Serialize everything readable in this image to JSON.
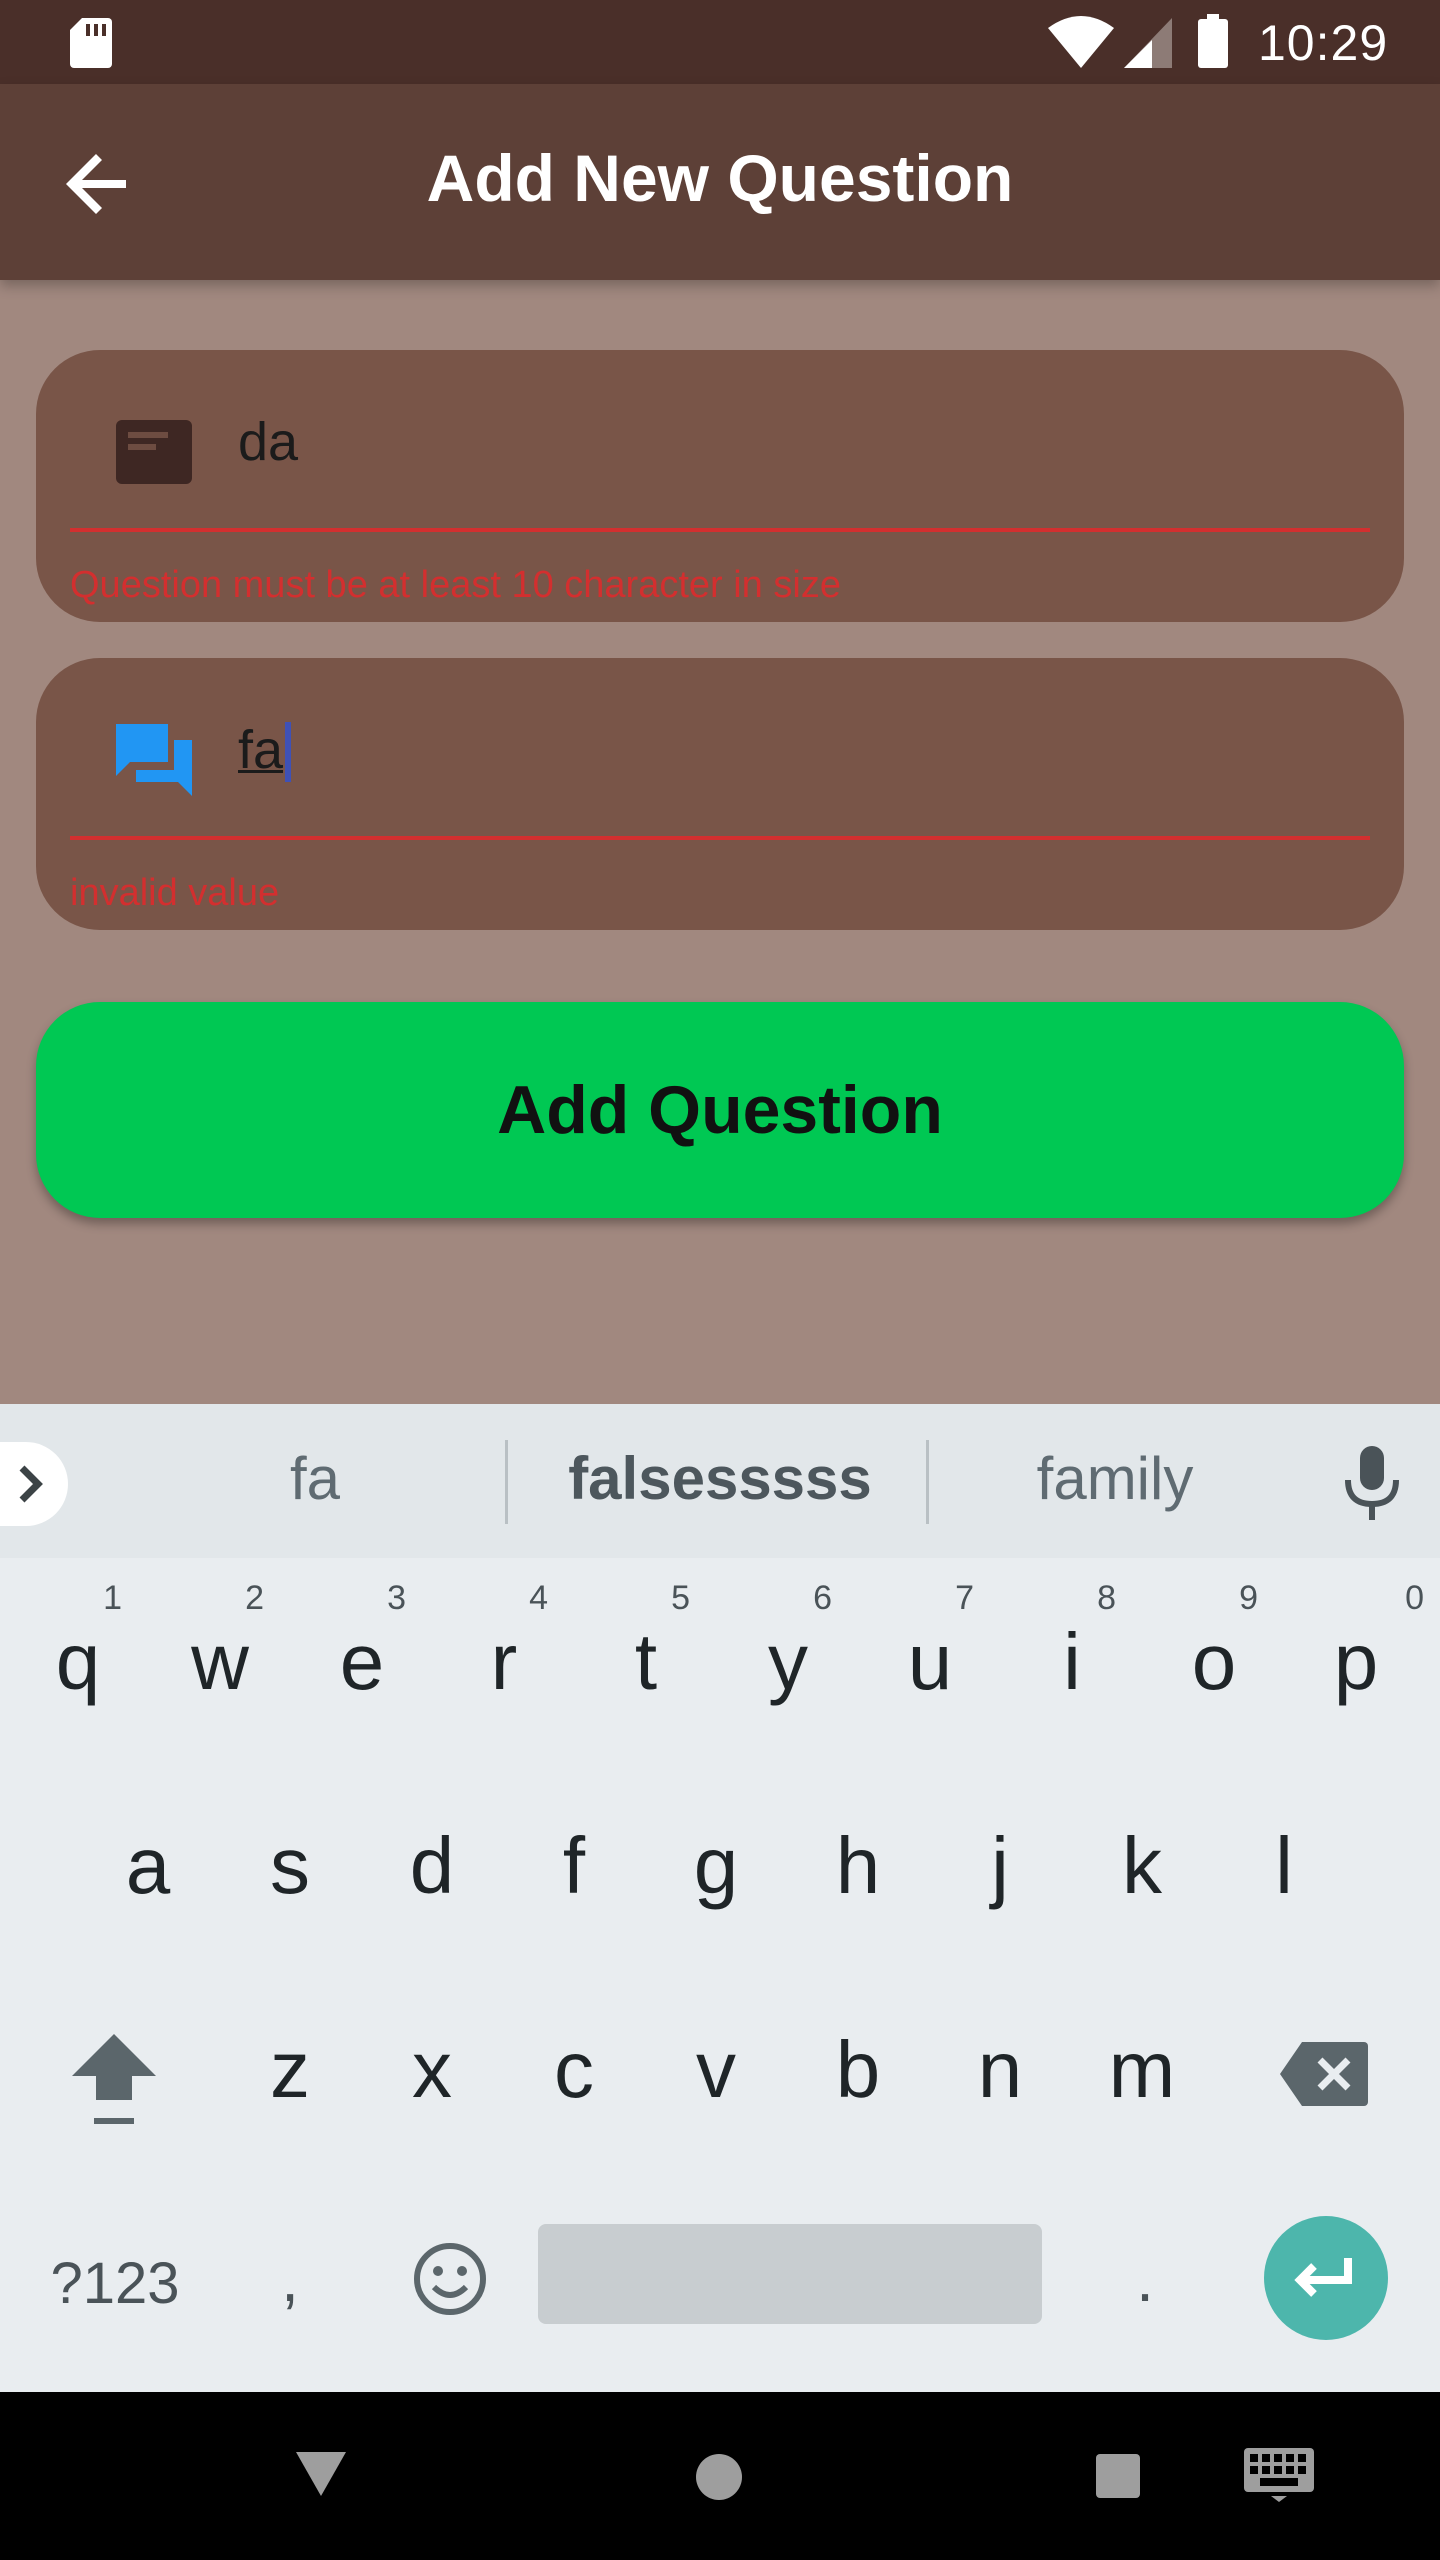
{
  "status_bar": {
    "time": "10:29"
  },
  "app_bar": {
    "title": "Add New Question",
    "back_icon": "arrow-back-icon"
  },
  "form": {
    "question_field": {
      "icon": "card-icon",
      "value": "da",
      "error": "Question must be at least 10 character in size"
    },
    "answer_field": {
      "icon": "forum-icon",
      "value": "fa",
      "error": "invalid value"
    },
    "submit_label": "Add Question"
  },
  "colors": {
    "status_bar": "#4a2f29",
    "app_bar": "#5d4037",
    "background": "#a1887f",
    "field": "#795548",
    "error": "#d32f2f",
    "button": "#00c853",
    "keyboard": "#e9edf0",
    "enter_key": "#4db6ac"
  },
  "keyboard": {
    "suggestions": [
      "fa",
      "falsesssss",
      "family"
    ],
    "row1": [
      {
        "key": "q",
        "hint": "1"
      },
      {
        "key": "w",
        "hint": "2"
      },
      {
        "key": "e",
        "hint": "3"
      },
      {
        "key": "r",
        "hint": "4"
      },
      {
        "key": "t",
        "hint": "5"
      },
      {
        "key": "y",
        "hint": "6"
      },
      {
        "key": "u",
        "hint": "7"
      },
      {
        "key": "i",
        "hint": "8"
      },
      {
        "key": "o",
        "hint": "9"
      },
      {
        "key": "p",
        "hint": "0"
      }
    ],
    "row2": [
      "a",
      "s",
      "d",
      "f",
      "g",
      "h",
      "j",
      "k",
      "l"
    ],
    "row3": [
      "z",
      "x",
      "c",
      "v",
      "b",
      "n",
      "m"
    ],
    "symbols_label": "?123",
    "comma_label": ",",
    "period_label": "."
  }
}
